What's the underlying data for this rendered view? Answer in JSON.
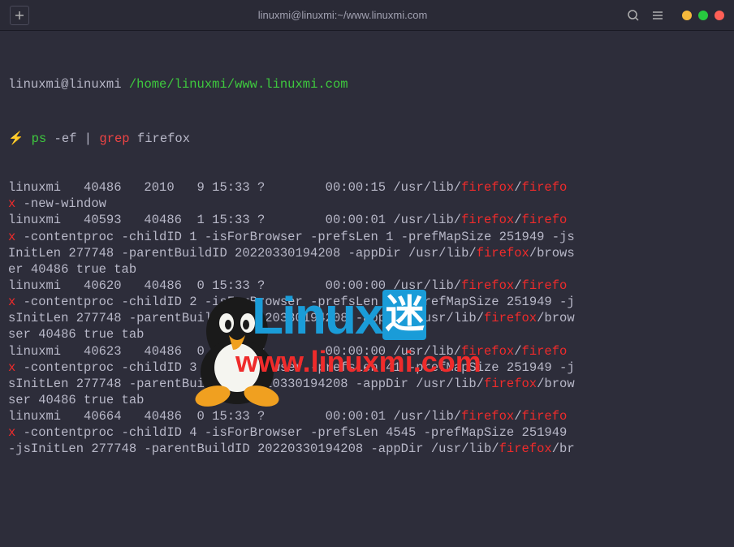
{
  "titlebar": {
    "title": "linuxmi@linuxmi:~/www.linuxmi.com"
  },
  "prompt": {
    "user": "linuxmi@linuxmi",
    "path": "/home/linuxmi/www.linuxmi.com",
    "lightning": "⚡",
    "cmd_ps": "ps",
    "cmd_flags": "-ef",
    "pipe": "|",
    "cmd_grep": "grep",
    "cmd_arg": "firefox"
  },
  "output": [
    {
      "u": "linuxmi",
      "pid": "40486",
      "ppid": "2010",
      "c": "9",
      "time": "15:33",
      "tty": "?",
      "etime": "00:00:15",
      "path": "/usr/lib/",
      "h1": "firefox",
      "sep": "/",
      "h2": "firefo"
    },
    {
      "cont_x": "x",
      "cont": " -new-window"
    },
    {
      "u": "linuxmi",
      "pid": "40593",
      "ppid": "40486",
      "c": "1",
      "time": "15:33",
      "tty": "?",
      "etime": "00:00:01",
      "path": "/usr/lib/",
      "h1": "firefox",
      "sep": "/",
      "h2": "firefo"
    },
    {
      "cont_x": "x",
      "cont": " -contentproc -childID 1 -isForBrowser -prefsLen 1 -prefMapSize 251949 -js"
    },
    {
      "cont": "InitLen 277748 -parentBuildID 20220330194208 -appDir /usr/lib/",
      "h1": "firefox",
      "cont2": "/brows"
    },
    {
      "cont": "er 40486 true tab"
    },
    {
      "u": "linuxmi",
      "pid": "40620",
      "ppid": "40486",
      "c": "0",
      "time": "15:33",
      "tty": "?",
      "etime": "00:00:00",
      "path": "/usr/lib/",
      "h1": "firefox",
      "sep": "/",
      "h2": "firefo"
    },
    {
      "cont_x": "x",
      "cont": " -contentproc -childID 2 -isForBrowser -prefsLen 41 -prefMapSize 251949 -j"
    },
    {
      "cont": "sInitLen 277748 -parentBuildID 20220330194208 -appDir /usr/lib/",
      "h1": "firefox",
      "cont2": "/brow"
    },
    {
      "cont": "ser 40486 true tab"
    },
    {
      "u": "linuxmi",
      "pid": "40623",
      "ppid": "40486",
      "c": "0",
      "time": "15:33",
      "tty": "?",
      "etime": "00:00:00",
      "path": "/usr/lib/",
      "h1": "firefox",
      "sep": "/",
      "h2": "firefo"
    },
    {
      "cont_x": "x",
      "cont": " -contentproc -childID 3 -isForBrowser -prefsLen 41 -prefMapSize 251949 -j"
    },
    {
      "cont": "sInitLen 277748 -parentBuildID 20220330194208 -appDir /usr/lib/",
      "h1": "firefox",
      "cont2": "/brow"
    },
    {
      "cont": "ser 40486 true tab"
    },
    {
      "u": "linuxmi",
      "pid": "40664",
      "ppid": "40486",
      "c": "0",
      "time": "15:33",
      "tty": "?",
      "etime": "00:00:01",
      "path": "/usr/lib/",
      "h1": "firefox",
      "sep": "/",
      "h2": "firefo"
    },
    {
      "cont_x": "x",
      "cont": " -contentproc -childID 4 -isForBrowser -prefsLen 4545 -prefMapSize 251949 "
    },
    {
      "cont": "-jsInitLen 277748 -parentBuildID 20220330194208 -appDir /usr/lib/",
      "h1": "firefox",
      "cont2": "/br"
    }
  ],
  "watermark": {
    "brand_linux": "Linux",
    "brand_mi": "迷",
    "url": "www.linuxmi.com"
  }
}
